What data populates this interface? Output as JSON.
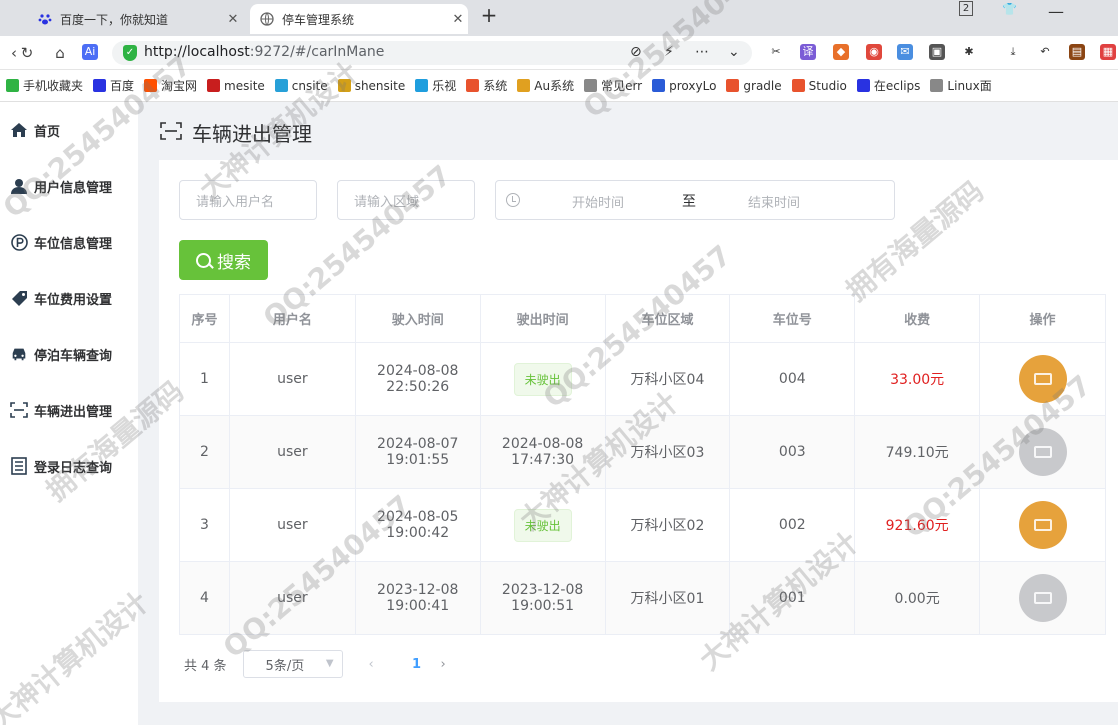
{
  "browser": {
    "tabs": [
      {
        "label": "百度一下，你就知道",
        "active": false,
        "icon": "baidu-paw-icon"
      },
      {
        "label": "停车管理系统",
        "active": true,
        "icon": "globe-icon"
      }
    ],
    "window_badge": "2",
    "url_host": "http://localhost",
    "url_rest": ":9272/#/carInMane",
    "bookmarks": [
      {
        "label": "手机收藏夹",
        "color": "#2fb344"
      },
      {
        "label": "百度",
        "color": "#2932e1"
      },
      {
        "label": "淘宝网",
        "color": "#ff5000"
      },
      {
        "label": "mesite",
        "color": "#c81e1e"
      },
      {
        "label": "cnsite",
        "color": "#27a0d8"
      },
      {
        "label": "shensite",
        "color": "#d4a017"
      },
      {
        "label": "乐视",
        "color": "#1f9ede"
      },
      {
        "label": "系统",
        "color": "#e8532e"
      },
      {
        "label": "Au系统",
        "color": "#e0a020"
      },
      {
        "label": "常见err",
        "color": "#888888"
      },
      {
        "label": "proxyLo",
        "color": "#2a5bd7"
      },
      {
        "label": "gradle",
        "color": "#e8532e"
      },
      {
        "label": "Studio",
        "color": "#e8532e"
      },
      {
        "label": "在eclips",
        "color": "#2932e1"
      },
      {
        "label": "Linux面",
        "color": "#888888"
      }
    ]
  },
  "sidebar": {
    "items": [
      {
        "label": "首页",
        "icon": "home-icon"
      },
      {
        "label": "用户信息管理",
        "icon": "user-icon"
      },
      {
        "label": "车位信息管理",
        "icon": "parking-icon"
      },
      {
        "label": "车位费用设置",
        "icon": "price-tag-icon"
      },
      {
        "label": "停泊车辆查询",
        "icon": "car-icon"
      },
      {
        "label": "车辆进出管理",
        "icon": "scan-icon"
      },
      {
        "label": "登录日志查询",
        "icon": "log-icon"
      }
    ]
  },
  "page": {
    "title": "车辆进出管理"
  },
  "filters": {
    "username_placeholder": "请输入用户名",
    "area_placeholder": "请输入区域",
    "start_placeholder": "开始时间",
    "range_separator": "至",
    "end_placeholder": "结束时间",
    "search_label": "搜索"
  },
  "table": {
    "headers": [
      "序号",
      "用户名",
      "驶入时间",
      "驶出时间",
      "车位区域",
      "车位号",
      "收费",
      "操作"
    ],
    "rows": [
      {
        "index": "1",
        "user": "user",
        "in_time": "2024-08-08 22:50:26",
        "out_time": "未驶出",
        "area": "万科小区04",
        "spot": "004",
        "fee": "33.00元",
        "exited": false
      },
      {
        "index": "2",
        "user": "user",
        "in_time": "2024-08-07 19:01:55",
        "out_time": "2024-08-08 17:47:30",
        "area": "万科小区03",
        "spot": "003",
        "fee": "749.10元",
        "exited": true
      },
      {
        "index": "3",
        "user": "user",
        "in_time": "2024-08-05 19:00:42",
        "out_time": "未驶出",
        "area": "万科小区02",
        "spot": "002",
        "fee": "921.60元",
        "exited": false
      },
      {
        "index": "4",
        "user": "user",
        "in_time": "2023-12-08 19:00:41",
        "out_time": "2023-12-08 19:00:51",
        "area": "万科小区01",
        "spot": "001",
        "fee": "0.00元",
        "exited": true
      }
    ]
  },
  "pagination": {
    "total": "共 4 条",
    "page_size": "5条/页",
    "current_page": "1"
  },
  "colors": {
    "accent_green": "#67c23a",
    "op_active": "#e6a23c",
    "op_disabled": "#c8c9cc",
    "fee_red": "#e02020",
    "page_blue": "#409eff"
  },
  "watermarks": [
    "QQ:254540457",
    "大神计算机设计",
    "拥有海量源码"
  ]
}
